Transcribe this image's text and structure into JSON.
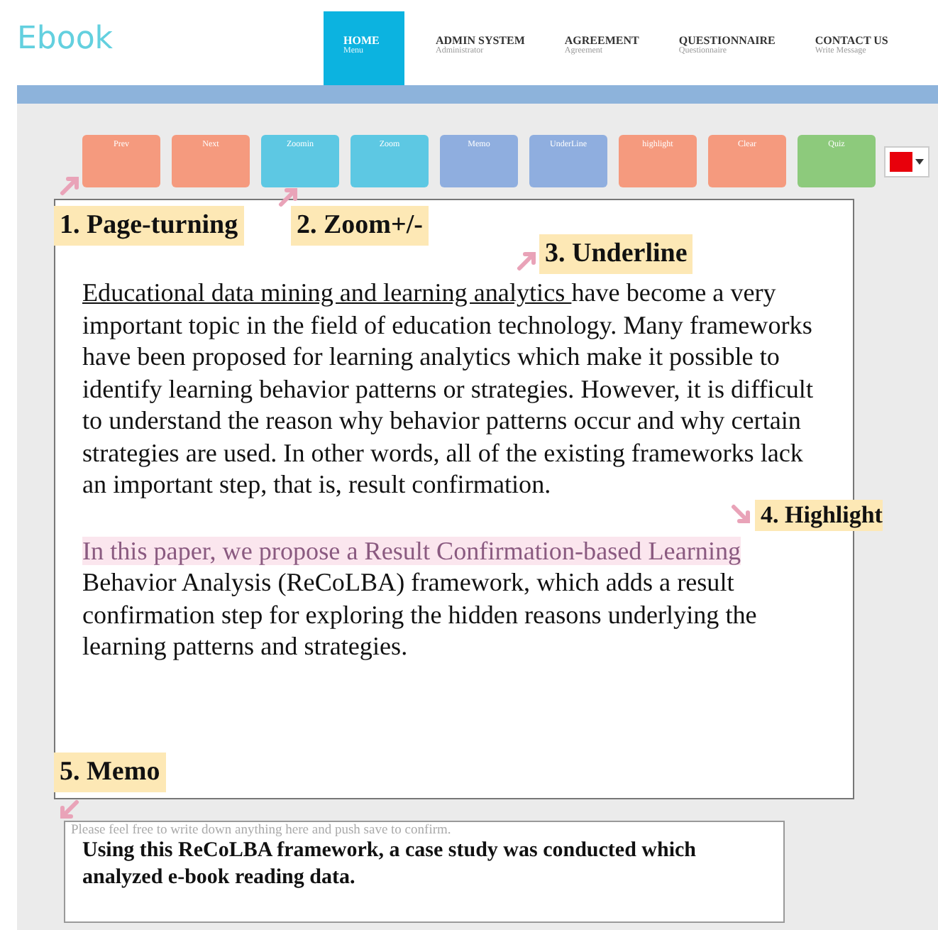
{
  "header": {
    "logo": "Ebook",
    "nav": [
      {
        "title": "HOME",
        "subtitle": "Menu",
        "selected": true
      },
      {
        "title": "ADMIN SYSTEM",
        "subtitle": "Administrator",
        "selected": false
      },
      {
        "title": "AGREEMENT",
        "subtitle": "Agreement",
        "selected": false
      },
      {
        "title": "QUESTIONNAIRE",
        "subtitle": "Questionnaire",
        "selected": false
      },
      {
        "title": "CONTACT US",
        "subtitle": "Write Message",
        "selected": false
      }
    ]
  },
  "toolbar": {
    "buttons": [
      {
        "label": "Prev",
        "color": "#f59a7e"
      },
      {
        "label": "Next",
        "color": "#f59a7e"
      },
      {
        "label": "Zoomin",
        "color": "#5dc8e3"
      },
      {
        "label": "Zoom",
        "color": "#5dc8e3"
      },
      {
        "label": "Memo",
        "color": "#8faedf"
      },
      {
        "label": "UnderLine",
        "color": "#8faedf"
      },
      {
        "label": "highlight",
        "color": "#f59a7e"
      },
      {
        "label": "Clear",
        "color": "#f59a7e"
      },
      {
        "label": "Quiz",
        "color": "#8dca7c"
      }
    ],
    "color_picker": {
      "color": "#e8000b"
    }
  },
  "callouts": [
    "1. Page-turning",
    "2. Zoom+/-",
    "3. Underline",
    "4. Highlight",
    "5. Memo"
  ],
  "document": {
    "paragraphs": [
      {
        "segments": [
          {
            "text": "Educational data mining and learning analytics ",
            "underlined": true,
            "highlighted": false
          },
          {
            "text": "have become a very important topic in the field of education technology. Many frameworks have been proposed for learning analytics which make it possible to identify learning behavior patterns or strategies. However, it is difficult to understand the reason why behavior patterns occur and why certain strategies are used. In other words, all of the existing frameworks lack an important step, that is, result confirmation.",
            "underlined": false,
            "highlighted": false
          }
        ]
      },
      {
        "segments": [
          {
            "text": "In this paper, we propose a Result Confirmation-based Learning",
            "underlined": false,
            "highlighted": true
          },
          {
            "text": " Behavior Analysis (ReCoLBA) framework, which adds a result confirmation step for exploring the hidden reasons underlying the learning patterns and strategies.",
            "underlined": false,
            "highlighted": false
          }
        ]
      }
    ]
  },
  "memo": {
    "placeholder": "Please feel free to write down anything here and push save to confirm.",
    "value": "Using this ReCoLBA framework, a case study was conducted which analyzed e-book reading data."
  }
}
